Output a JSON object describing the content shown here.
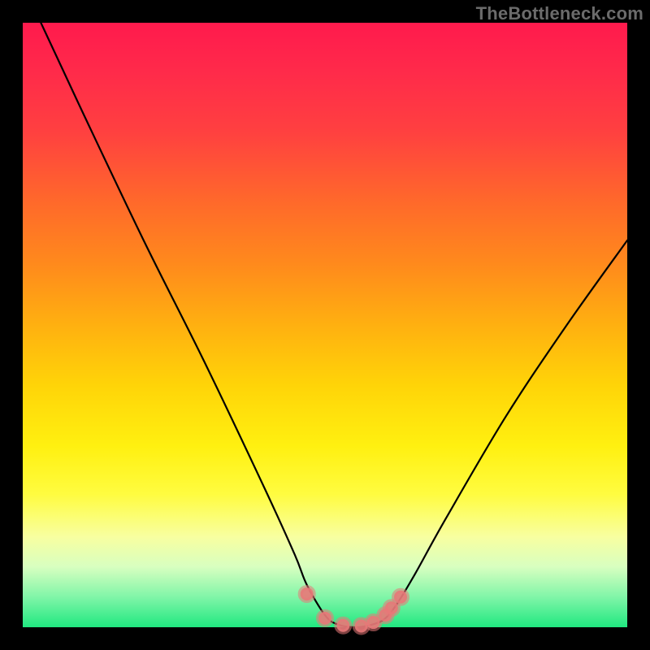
{
  "watermark": "TheBottleneck.com",
  "chart_data": {
    "type": "line",
    "title": "",
    "xlabel": "",
    "ylabel": "",
    "xlim": [
      0,
      100
    ],
    "ylim": [
      0,
      100
    ],
    "series": [
      {
        "name": "bottleneck-curve",
        "x": [
          3,
          10,
          20,
          30,
          40,
          45,
          47,
          50,
          52,
          55,
          58,
          60,
          62,
          65,
          70,
          80,
          90,
          100
        ],
        "y": [
          100,
          85,
          64,
          44,
          23,
          12,
          7,
          2,
          0.5,
          0,
          0.5,
          1.5,
          4,
          9,
          18,
          35,
          50,
          64
        ]
      }
    ],
    "markers": {
      "name": "highlight-points",
      "x": [
        47,
        50,
        53,
        56,
        58,
        60,
        61,
        62.5
      ],
      "y": [
        5.5,
        1.5,
        0.3,
        0.2,
        0.8,
        2,
        3.2,
        5
      ]
    }
  }
}
